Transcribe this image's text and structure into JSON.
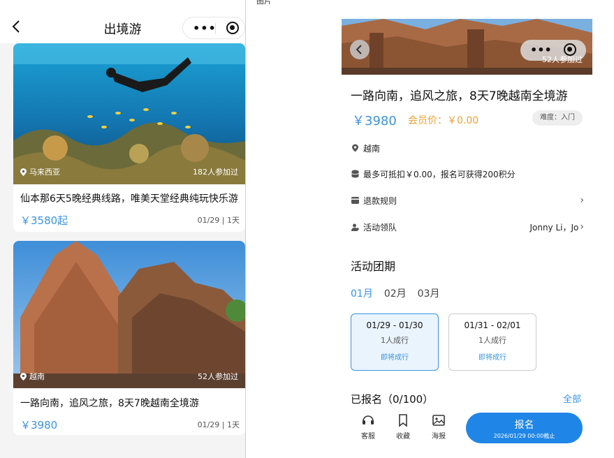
{
  "left": {
    "nav_title": "出境游",
    "cards": [
      {
        "location": "马来西亚",
        "participants": "182人参加过",
        "title": "仙本那6天5晚经典线路，唯美天堂经典纯玩快乐游",
        "price": "￥3580起",
        "meta": "01/29 | 1天"
      },
      {
        "location": "越南",
        "participants": "52人参加过",
        "title": "一路向南，追风之旅，8天7晚越南全境游",
        "price": "￥3980",
        "meta": "01/29 | 1天"
      }
    ]
  },
  "right": {
    "image_label": "图片",
    "hero_participants": "52人参加过",
    "title": "一路向南，追风之旅，8天7晚越南全境游",
    "price": "￥3980",
    "member_price": "会员价：￥0.00",
    "difficulty": "难度：入门",
    "info": {
      "location": "越南",
      "points": "最多可抵扣￥0.00，报名可获得200积分",
      "refund": "退款规则",
      "leader_label": "活动领队",
      "leader_value": "Jonny Li，Jo"
    },
    "schedule_title": "活动团期",
    "months": [
      "01月",
      "02月",
      "03月"
    ],
    "periods": [
      {
        "range": "01/29 - 01/30",
        "count": "1人成行",
        "status": "即将成行"
      },
      {
        "range": "01/31 - 02/01",
        "count": "1人成行",
        "status": "即将成行"
      }
    ],
    "signed": "已报名（0/100）",
    "all": "全部",
    "tabs": [
      "客服",
      "收藏",
      "海报"
    ],
    "cta": {
      "label": "报名",
      "deadline": "2026/01/29 00:00截止"
    }
  },
  "colors": {
    "accent": "#1f86e8",
    "price": "#3a93e6",
    "member": "#f0a030"
  }
}
